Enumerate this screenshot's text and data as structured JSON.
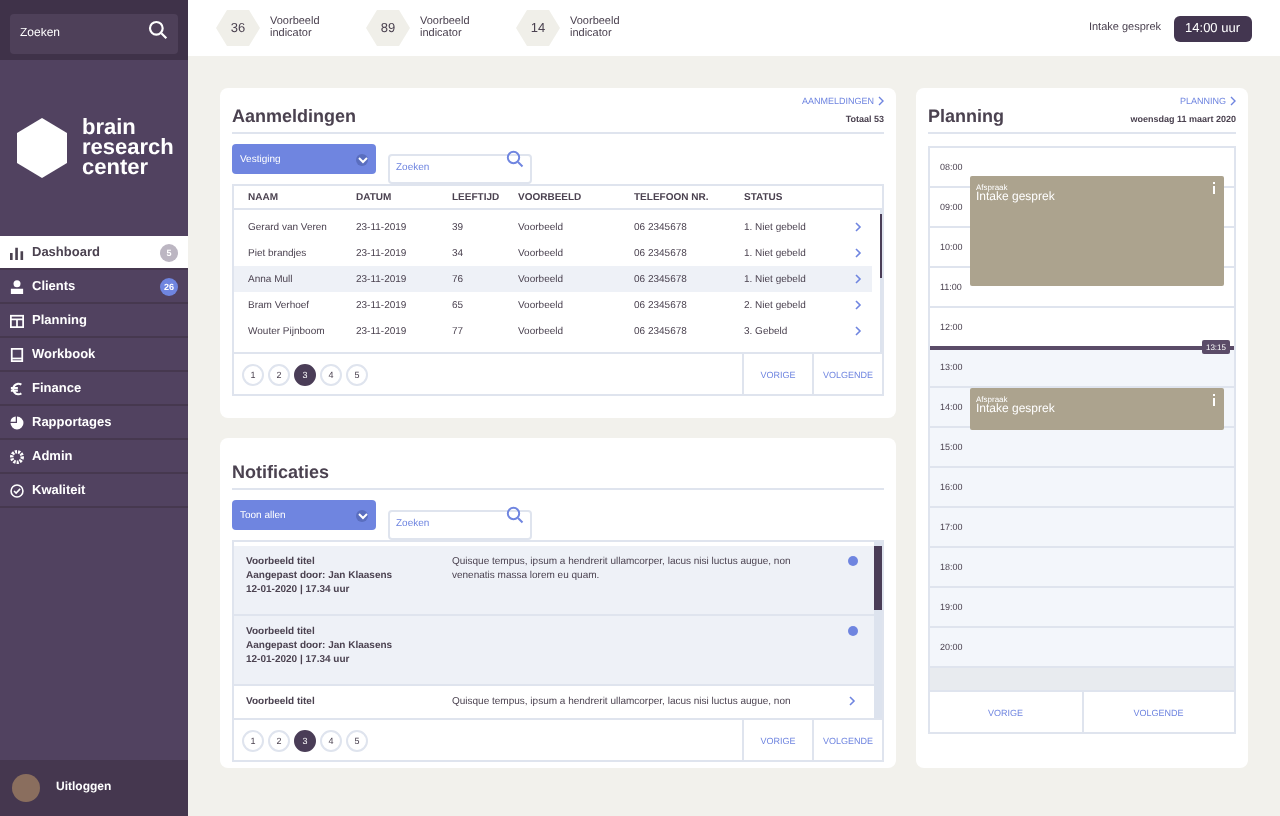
{
  "sidebar": {
    "search": {
      "placeholder": "Zoeken"
    },
    "logo": "brain research center",
    "items": [
      {
        "label": "Dashboard",
        "kind": "chart",
        "selected": true,
        "badge": "5",
        "color": "#bcb6c2"
      },
      {
        "label": "Clients",
        "kind": "person",
        "selected": false,
        "badge": "26",
        "color": "#6f85e0"
      },
      {
        "label": "Planning",
        "kind": "calendar",
        "selected": false
      },
      {
        "label": "Workbook",
        "kind": "book",
        "selected": false
      },
      {
        "label": "Finance",
        "kind": "euro",
        "selected": false
      },
      {
        "label": "Rapportages",
        "kind": "pie",
        "selected": false
      },
      {
        "label": "Admin",
        "kind": "gear",
        "selected": false
      },
      {
        "label": "Kwaliteit",
        "kind": "check",
        "selected": false
      }
    ],
    "logout": "Uitloggen"
  },
  "top_bar": {
    "indicators": [
      {
        "value": "36",
        "label": "Voorbeeld indicator"
      },
      {
        "value": "89",
        "label": "Voorbeeld indicator"
      },
      {
        "value": "14",
        "label": "Voorbeeld indicator"
      }
    ],
    "next_label": "Intake gesprek",
    "next_time": "14:00 uur"
  },
  "registrations": {
    "link": "AANMELDINGEN",
    "title": "Aanmeldingen",
    "total": "Totaal 53",
    "filter": "Vestiging",
    "search": {
      "placeholder": "Zoeken"
    },
    "columns": [
      "NAAM",
      "DATUM",
      "LEEFTIJD",
      "VOORBEELD",
      "TELEFOON NR.",
      "STATUS"
    ],
    "rows": [
      {
        "cells": [
          "Gerard van Veren",
          "23-11-2019",
          "39",
          "Voorbeeld",
          "06 2345678",
          "1. Niet gebeld"
        ],
        "selected": false
      },
      {
        "cells": [
          "Piet brandjes",
          "23-11-2019",
          "34",
          "Voorbeeld",
          "06 2345678",
          "1. Niet gebeld"
        ],
        "selected": false
      },
      {
        "cells": [
          "Anna Mull",
          "23-11-2019",
          "76",
          "Voorbeeld",
          "06 2345678",
          "1. Niet gebeld"
        ],
        "selected": true
      },
      {
        "cells": [
          "Bram Verhoef",
          "23-11-2019",
          "65",
          "Voorbeeld",
          "06 2345678",
          "2. Niet gebeld"
        ],
        "selected": false
      },
      {
        "cells": [
          "Wouter Pijnboom",
          "23-11-2019",
          "77",
          "Voorbeeld",
          "06 2345678",
          "3. Gebeld"
        ],
        "selected": false
      }
    ],
    "pages": [
      {
        "label": "1",
        "selected": false
      },
      {
        "label": "2",
        "selected": false
      },
      {
        "label": "3",
        "selected": true
      },
      {
        "label": "4",
        "selected": false
      },
      {
        "label": "5",
        "selected": false
      }
    ],
    "prev": "VORIGE",
    "next": "VOLGENDE"
  },
  "notifications": {
    "title": "Notificaties",
    "filter": "Toon allen",
    "search": {
      "placeholder": "Zoeken"
    },
    "items": [
      {
        "title": "Voorbeeld titel",
        "author": "Aangepast door: Jan Klaasens",
        "date": "12-01-2020  | 17.34 uur",
        "text": "Quisque tempus, ipsum a hendrerit ullamcorper, lacus nisi luctus augue, non venenatis massa lorem eu quam.",
        "unread": true
      },
      {
        "title": "Voorbeeld titel",
        "author": "Aangepast door: Jan Klaasens",
        "date": "12-01-2020  | 17.34 uur",
        "unread": true
      },
      {
        "title": "Voorbeeld titel",
        "text": "Quisque tempus, ipsum a hendrerit ullamcorper, lacus nisi luctus augue, non",
        "unread": false
      }
    ],
    "pages": [
      {
        "label": "1",
        "selected": false
      },
      {
        "label": "2",
        "selected": false
      },
      {
        "label": "3",
        "selected": true
      },
      {
        "label": "4",
        "selected": false
      },
      {
        "label": "5",
        "selected": false
      }
    ],
    "prev": "VORIGE",
    "next": "VOLGENDE"
  },
  "planning": {
    "link": "PLANNING",
    "title": "Planning",
    "date": "woensdag 11 maart 2020",
    "hours": [
      {
        "time": "08:00",
        "past": true
      },
      {
        "time": "09:00",
        "past": true,
        "appointment": {
          "kind": "long",
          "label": "Afspraak",
          "title": "Intake gesprek"
        }
      },
      {
        "time": "10:00",
        "past": true
      },
      {
        "time": "11:00",
        "past": true
      },
      {
        "time": "12:00",
        "past": true,
        "now": "13:15"
      },
      {
        "time": "13:00",
        "past": false
      },
      {
        "time": "14:00",
        "past": false,
        "appointment": {
          "kind": "short",
          "label": "Afspraak",
          "title": "Intake gesprek"
        }
      },
      {
        "time": "15:00",
        "past": false
      },
      {
        "time": "16:00",
        "past": false
      },
      {
        "time": "17:00",
        "past": false
      },
      {
        "time": "18:00",
        "past": false
      },
      {
        "time": "19:00",
        "past": false
      },
      {
        "time": "20:00",
        "past": false
      }
    ],
    "prev": "VORIGE",
    "next": "VOLGENDE"
  }
}
